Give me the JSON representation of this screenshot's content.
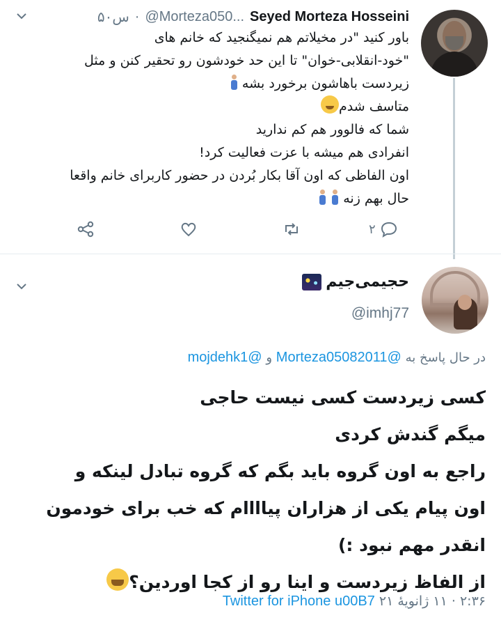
{
  "tweet1": {
    "author_name": "Seyed Morteza Hosseini",
    "handle": "@Morteza050...",
    "time": "۵۰س",
    "separator": "·",
    "lines": [
      "باور کنید \"در مخیلاتم هم نمیگنجید که خانم های",
      "\"خود-انقلابی-خوان\" تا این حد خودشون رو تحقیر کنن و مثل",
      "زیردست باهاشون برخورد بشه",
      "متاسف شدم",
      "شما که فالوور هم کم ندارید",
      "انفرادی هم میشه با عزت فعالیت کرد!",
      "اون الفاظی که اون آقا بکار بُردن در حضور کاربرای خانم واقعا",
      "حال بهم زنه"
    ],
    "reply_count": "۲",
    "icons": {
      "reply": "reply-icon",
      "retweet": "retweet-icon",
      "like": "heart-icon",
      "share": "share-icon",
      "menu": "chevron-down-icon"
    }
  },
  "tweet2": {
    "display_name": "حجیمی‌جیم",
    "handle": "@imhj77",
    "replying_prefix": "در حال پاسخ به",
    "mention1": "@Morteza05082011",
    "conjunction": "و",
    "mention2": "@mojdehk1",
    "lines": [
      "کسی زیردست کسی نیست حاجی",
      "میگم گندش کردی",
      "راجع به اون گروه باید بگم که گروه تبادل لینکه و",
      "اون پیام یکی از هزاران پیاااام که خب برای خودمون",
      "انقدر مهم نبود :)",
      "از الفاظ زیردست و اینا رو از کجا اوردین؟"
    ],
    "time": "۲:۳۶",
    "date": "۱۱ ژانویهٔ ۲۱",
    "dot": "·",
    "client_text": "Twitter for iPhone u00B7"
  },
  "colors": {
    "link": "#1b95e0",
    "secondary": "#657786",
    "text": "#14171a",
    "thread_line": "#c4cfd6"
  }
}
